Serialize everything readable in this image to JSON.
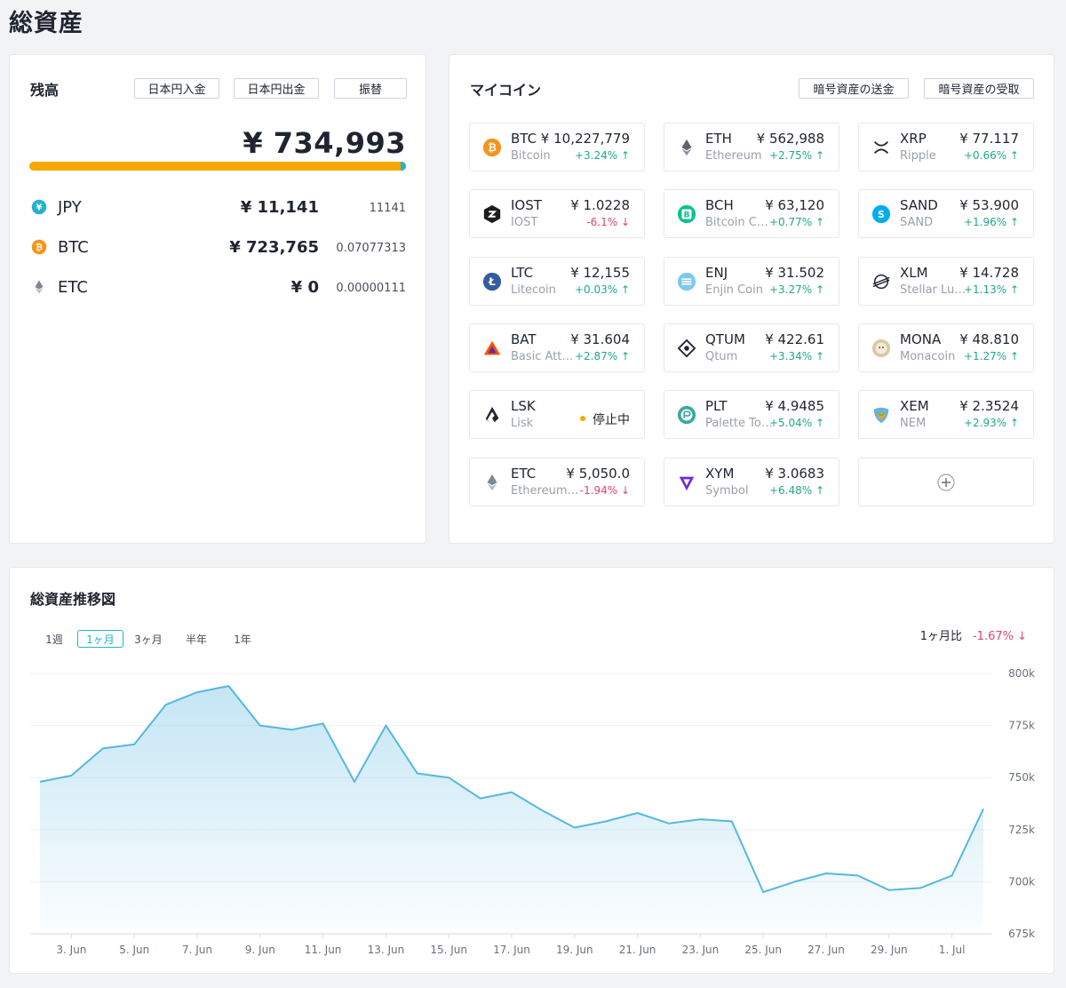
{
  "page": {
    "title": "総資産"
  },
  "balance": {
    "title": "残高",
    "buttons": {
      "deposit": "日本円入金",
      "withdraw": "日本円出金",
      "transfer": "振替"
    },
    "total": "¥ 734,993",
    "bar": {
      "btc_percent": 98.5,
      "jpy_percent": 1.5,
      "btc_color": "#f5a800",
      "jpy_color": "#23b1d3"
    },
    "assets": [
      {
        "symbol": "JPY",
        "value": "¥ 11,141",
        "amount": "11141",
        "icon": "jpy-icon"
      },
      {
        "symbol": "BTC",
        "value": "¥ 723,765",
        "amount": "0.07077313",
        "icon": "bitcoin-icon"
      },
      {
        "symbol": "ETC",
        "value": "¥ 0",
        "amount": "0.00000111",
        "icon": "ethereum-classic-icon"
      }
    ]
  },
  "mycoin": {
    "title": "マイコイン",
    "buttons": {
      "send": "暗号資産の送金",
      "receive": "暗号資産の受取"
    },
    "coins": [
      {
        "symbol": "BTC",
        "name": "Bitcoin",
        "price": "¥ 10,227,779",
        "change": "+3.24% ↑",
        "dir": "up",
        "icon": "bitcoin-icon"
      },
      {
        "symbol": "ETH",
        "name": "Ethereum",
        "price": "¥ 562,988",
        "change": "+2.75% ↑",
        "dir": "up",
        "icon": "ethereum-icon"
      },
      {
        "symbol": "XRP",
        "name": "Ripple",
        "price": "¥ 77.117",
        "change": "+0.66% ↑",
        "dir": "up",
        "icon": "ripple-icon"
      },
      {
        "symbol": "IOST",
        "name": "IOST",
        "price": "¥ 1.0228",
        "change": "-6.1% ↓",
        "dir": "down",
        "icon": "iost-icon"
      },
      {
        "symbol": "BCH",
        "name": "Bitcoin Cash",
        "price": "¥ 63,120",
        "change": "+0.77% ↑",
        "dir": "up",
        "icon": "bitcoin-cash-icon"
      },
      {
        "symbol": "SAND",
        "name": "SAND",
        "price": "¥ 53.900",
        "change": "+1.96% ↑",
        "dir": "up",
        "icon": "sand-icon"
      },
      {
        "symbol": "LTC",
        "name": "Litecoin",
        "price": "¥ 12,155",
        "change": "+0.03% ↑",
        "dir": "up",
        "icon": "litecoin-icon"
      },
      {
        "symbol": "ENJ",
        "name": "Enjin Coin",
        "price": "¥ 31.502",
        "change": "+3.27% ↑",
        "dir": "up",
        "icon": "enjin-icon"
      },
      {
        "symbol": "XLM",
        "name": "Stellar Lumens",
        "price": "¥ 14.728",
        "change": "+1.13% ↑",
        "dir": "up",
        "icon": "stellar-icon"
      },
      {
        "symbol": "BAT",
        "name": "Basic Attention Token",
        "price": "¥ 31.604",
        "change": "+2.87% ↑",
        "dir": "up",
        "icon": "bat-icon"
      },
      {
        "symbol": "QTUM",
        "name": "Qtum",
        "price": "¥ 422.61",
        "change": "+3.34% ↑",
        "dir": "up",
        "icon": "qtum-icon"
      },
      {
        "symbol": "MONA",
        "name": "Monacoin",
        "price": "¥ 48.810",
        "change": "+1.27% ↑",
        "dir": "up",
        "icon": "monacoin-icon"
      },
      {
        "symbol": "LSK",
        "name": "Lisk",
        "price": "",
        "change": "",
        "dir": "",
        "status": "停止中",
        "icon": "lisk-icon"
      },
      {
        "symbol": "PLT",
        "name": "Palette Token",
        "price": "¥ 4.9485",
        "change": "+5.04% ↑",
        "dir": "up",
        "icon": "palette-icon"
      },
      {
        "symbol": "XEM",
        "name": "NEM",
        "price": "¥ 2.3524",
        "change": "+2.93% ↑",
        "dir": "up",
        "icon": "nem-icon"
      },
      {
        "symbol": "ETC",
        "name": "Ethereum Classic",
        "price": "¥ 5,050.0",
        "change": "-1.94% ↓",
        "dir": "down",
        "icon": "ethereum-classic-icon"
      },
      {
        "symbol": "XYM",
        "name": "Symbol",
        "price": "¥ 3.0683",
        "change": "+6.48% ↑",
        "dir": "up",
        "icon": "symbol-icon"
      }
    ]
  },
  "history": {
    "title": "総資産推移図",
    "periods": [
      "1週",
      "1ヶ月",
      "3ヶ月",
      "半年",
      "1年"
    ],
    "active_period": "1ヶ月",
    "compare": {
      "label": "1ヶ月比",
      "value": "-1.67% ↓"
    }
  },
  "chart_data": {
    "type": "area",
    "x": [
      "2. Jun",
      "3. Jun",
      "4. Jun",
      "5. Jun",
      "6. Jun",
      "7. Jun",
      "8. Jun",
      "9. Jun",
      "10. Jun",
      "11. Jun",
      "12. Jun",
      "13. Jun",
      "14. Jun",
      "15. Jun",
      "16. Jun",
      "17. Jun",
      "18. Jun",
      "19. Jun",
      "20. Jun",
      "21. Jun",
      "22. Jun",
      "23. Jun",
      "24. Jun",
      "25. Jun",
      "26. Jun",
      "27. Jun",
      "28. Jun",
      "29. Jun",
      "30. Jun",
      "1. Jul",
      "2. Jul"
    ],
    "x_tick_labels": [
      "3. Jun",
      "5. Jun",
      "7. Jun",
      "9. Jun",
      "11. Jun",
      "13. Jun",
      "15. Jun",
      "17. Jun",
      "19. Jun",
      "21. Jun",
      "23. Jun",
      "25. Jun",
      "27. Jun",
      "29. Jun",
      "1. Jul"
    ],
    "values": [
      748000,
      751000,
      764000,
      766000,
      785000,
      791000,
      794000,
      775000,
      773000,
      776000,
      748000,
      775000,
      752000,
      750000,
      740000,
      743000,
      734000,
      726000,
      729000,
      733000,
      728000,
      730000,
      729000,
      695000,
      700000,
      704000,
      703000,
      696000,
      697000,
      703000,
      735000
    ],
    "y_ticks": [
      "800k",
      "775k",
      "750k",
      "725k",
      "700k",
      "675k"
    ],
    "ylim": [
      675000,
      800000
    ],
    "grid": true,
    "line_color": "#56b7e0"
  }
}
